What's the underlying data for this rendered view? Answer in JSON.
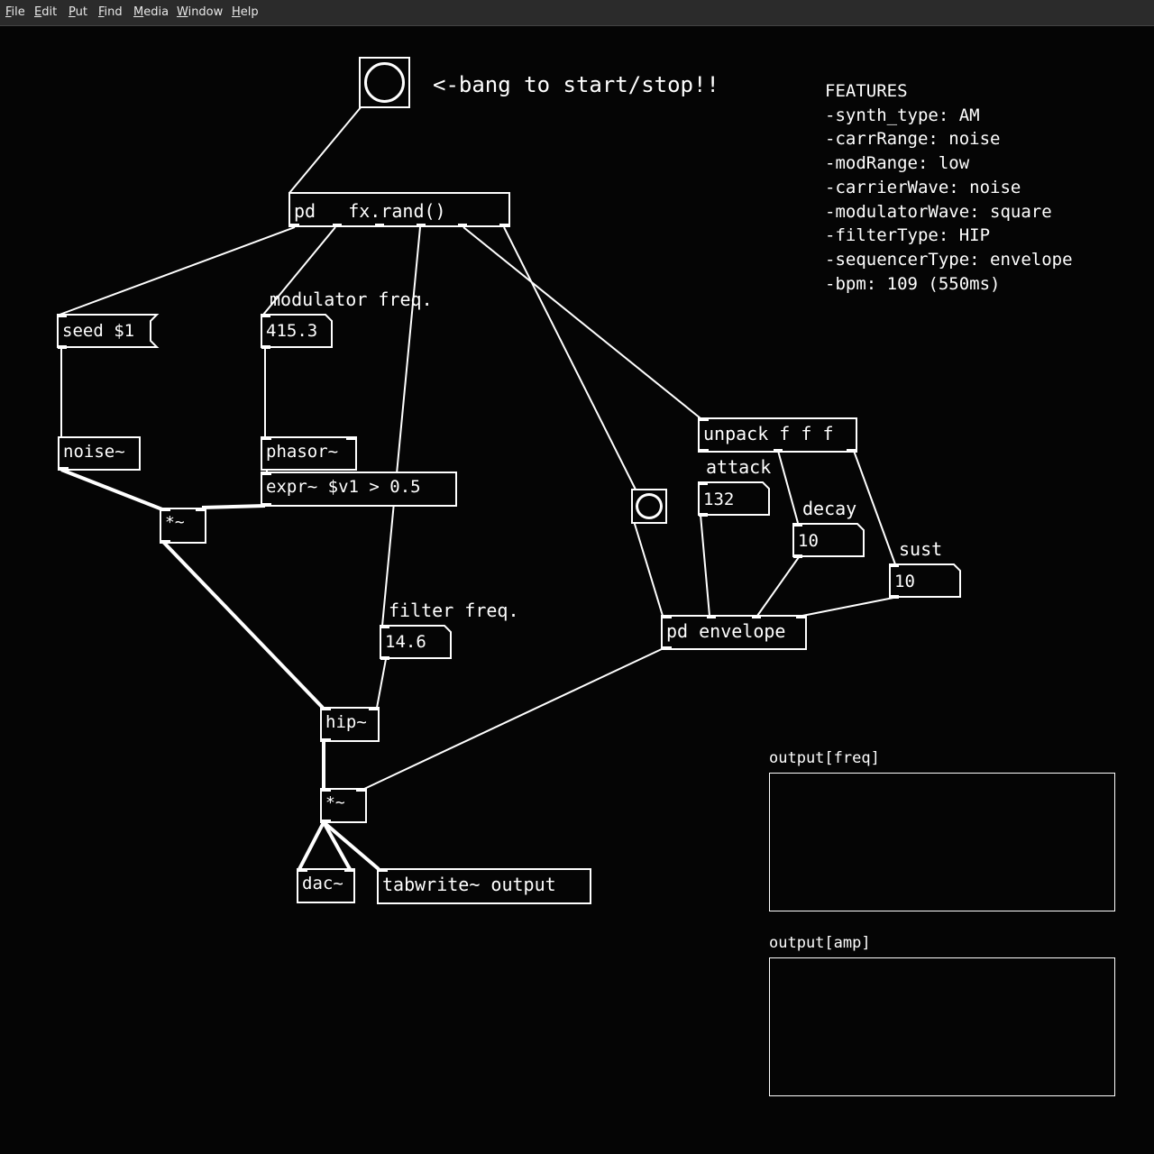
{
  "menu": [
    "File",
    "Edit",
    "Put",
    "Find",
    "Media",
    "Window",
    "Help"
  ],
  "comments": {
    "bang_hint": "<-bang to start/stop!!",
    "modulator_freq": "modulator freq.",
    "filter_freq": "filter freq.",
    "attack": "attack",
    "decay": "decay",
    "sust": "sust"
  },
  "features": {
    "title": "FEATURES",
    "lines": [
      "-synth_type: AM",
      "-carrRange: noise",
      "-modRange: low",
      "-carrierWave: noise",
      "-modulatorWave: square",
      "-filterType: HIP",
      "-sequencerType: envelope",
      "-bpm: 109 (550ms)"
    ]
  },
  "objects": {
    "pd_fx": "pd   fx.rand()",
    "seed_msg": "seed $1",
    "noise": "noise~",
    "phasor": "phasor~",
    "expr": "expr~ $v1 > 0.5",
    "mul1": "*~",
    "hip": "hip~",
    "mul2": "*~",
    "dac": "dac~",
    "tabwrite": "tabwrite~ output",
    "unpack": "unpack f f f",
    "pd_envelope": "pd envelope"
  },
  "numbers": {
    "modulator": "415.3",
    "filter": "14.6",
    "attack": "132",
    "decay": "10",
    "sust": "10"
  },
  "arrays": {
    "freq": "output[freq]",
    "amp": "output[amp]"
  },
  "colors": {
    "background": "#050505",
    "foreground": "#ffffff",
    "menubar": "#2b2b2b"
  }
}
